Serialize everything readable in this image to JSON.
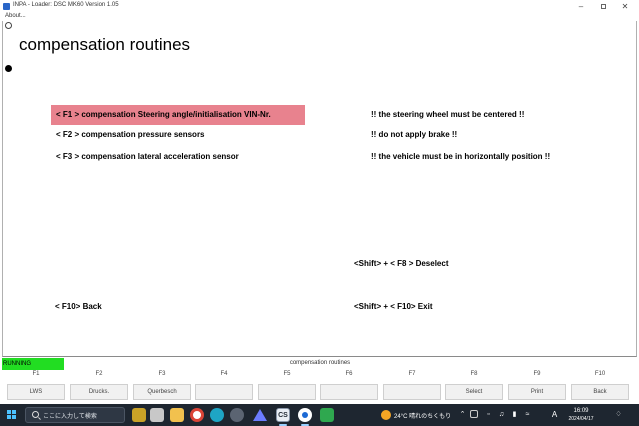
{
  "window": {
    "title": "INPA - Loader: DSC MK60 Version 1.05",
    "menu_about": "About..."
  },
  "main": {
    "title": "compensation routines",
    "rows": [
      {
        "label": "< F1 >  compensation Steering angle/initialisation VIN-Nr.",
        "note": "!! the steering wheel must be centered !!"
      },
      {
        "label": "< F2 >  compensation pressure sensors",
        "note": "!! do not apply brake !!"
      },
      {
        "label": "< F3 >  compensation lateral acceleration sensor",
        "note": "!! the vehicle must be in horizontally position !!"
      }
    ],
    "deselect": "<Shift> + < F8 >  Deselect",
    "back": "< F10>  Back",
    "exit": "<Shift> + < F10>  Exit"
  },
  "status": {
    "running": "RUNNING",
    "caption": "compensation routines",
    "running_color": "#22dd22"
  },
  "fkeys": {
    "labels": [
      "F1",
      "F2",
      "F3",
      "F4",
      "F5",
      "F6",
      "F7",
      "F8",
      "F9",
      "F10"
    ],
    "buttons": [
      "LWS",
      "Drucks.",
      "Querbesch",
      "",
      "",
      "",
      "",
      "Select",
      "Print",
      "Back"
    ]
  },
  "taskbar": {
    "search_placeholder": "ここに入力して検索",
    "cs_label": "CS",
    "weather": "24°C  晴れのちくもり",
    "ime": "A",
    "time": "16:09",
    "date": "2024/04/17"
  },
  "colors": {
    "selected_row": "#e8828e",
    "taskbar": "#1e2630"
  }
}
